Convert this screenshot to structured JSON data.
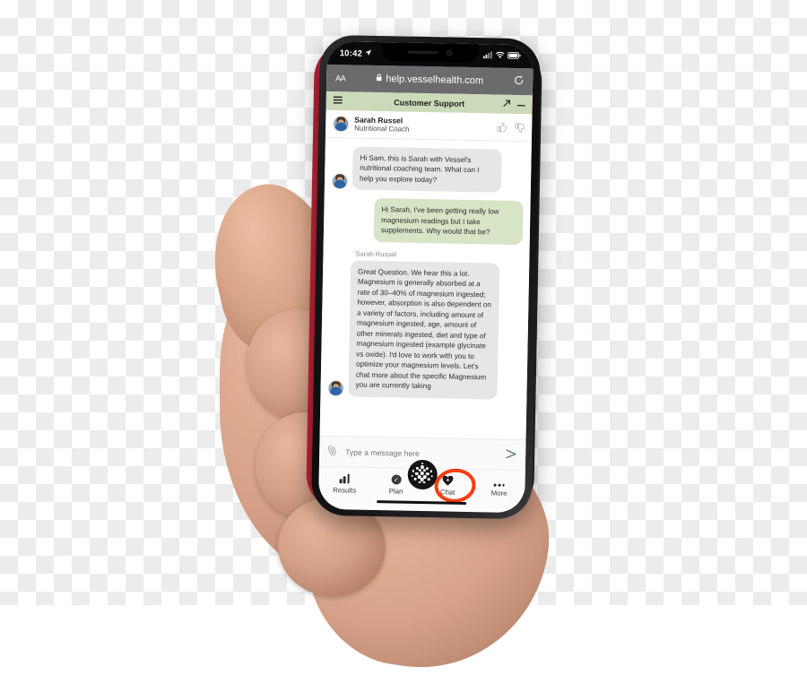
{
  "status_bar": {
    "time": "10:42",
    "location_icon": "location-arrow-icon",
    "signal_icon": "cellular-signal-icon",
    "wifi_icon": "wifi-icon",
    "battery_icon": "battery-icon"
  },
  "browser": {
    "text_size_label": "AA",
    "lock_icon": "lock-icon",
    "url": "help.vesselhealth.com",
    "reload_icon": "reload-icon"
  },
  "widget_header": {
    "menu_icon": "hamburger-menu-icon",
    "title": "Customer Support",
    "expand_icon": "expand-arrow-icon",
    "minimize_icon": "minimize-icon"
  },
  "agent": {
    "name": "Sarah Russel",
    "role": "Nutritional Coach",
    "avatar_name": "agent-avatar",
    "thumbs_up_icon": "thumbs-up-icon",
    "thumbs_down_icon": "thumbs-down-icon"
  },
  "messages": [
    {
      "from": "agent",
      "sender": "Sarah Russel",
      "show_sender_label": false,
      "show_avatar": true,
      "text": "Hi Sam, this is Sarah with Vessel's nutritional coaching team.  What can I help you explore today?"
    },
    {
      "from": "user",
      "sender": "Sam",
      "show_sender_label": false,
      "show_avatar": false,
      "text": "Hi Sarah, I've been getting really low magnesium readings but I take supplements. Why would that be?"
    },
    {
      "from": "agent",
      "sender": "Sarah Russel",
      "show_sender_label": true,
      "show_avatar": true,
      "text": "Great Question.  We hear this a lot.  Magnesium is generally absorbed at a rate of 30–40% of magnesium ingested; however, absorption is also dependent on a variety of factors, including amount of magnesium ingested, age, amount of other minerals ingested, diet and type of magnesium ingested (example glycinate vs oxide). I'd love to work with you to optimize your magnesium levels. Let's chat more about the specific Magnesium you are currently taking"
    }
  ],
  "composer": {
    "attach_icon": "paperclip-icon",
    "placeholder": "Type a message here",
    "value": "",
    "send_icon": "send-arrow-icon"
  },
  "tab_bar": {
    "tabs": [
      {
        "label": "Results",
        "icon": "bar-chart-icon",
        "active": false
      },
      {
        "label": "Plan",
        "icon": "check-circle-icon",
        "active": false
      },
      {
        "label": "Chat",
        "icon": "heart-plus-icon",
        "active": true
      },
      {
        "label": "More",
        "icon": "three-dots-icon",
        "active": false
      }
    ],
    "center_button_icon": "vessel-logo-icon",
    "highlight_color": "#f53d10",
    "highlighted_tab": "Chat"
  },
  "colors": {
    "widget_header_green": "#cbdab8",
    "user_bubble_green": "#d7e4c6",
    "agent_bubble_gray": "#e6e6e6",
    "highlight_orange": "#f53d10",
    "safari_bar_gray": "#6b6b6e"
  }
}
